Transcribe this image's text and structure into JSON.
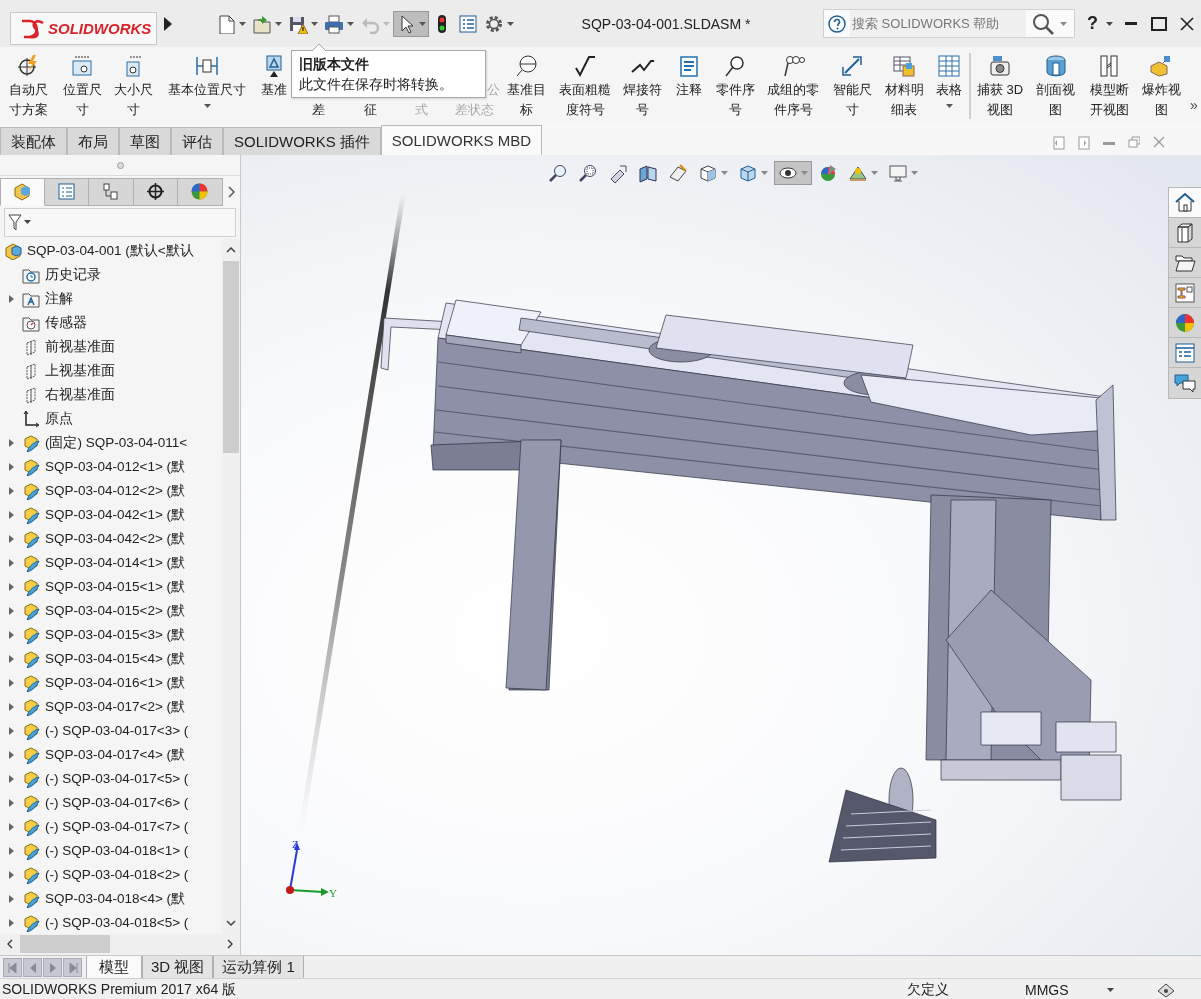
{
  "title_bar": {
    "logo": "SOLIDWORKS",
    "document_title": "SQP-03-04-001.SLDASM *",
    "search": {
      "placeholder": "搜索 SOLIDWORKS 帮助"
    },
    "help": "?"
  },
  "quick_access": [
    {
      "dropdown": true,
      "disabled": false,
      "pressed": false
    },
    {
      "dropdown": true,
      "disabled": false,
      "pressed": false
    },
    {
      "dropdown": true,
      "disabled": false,
      "pressed": false
    },
    {
      "dropdown": true,
      "disabled": false,
      "pressed": false
    },
    {
      "dropdown": true,
      "disabled": true,
      "pressed": false
    },
    {
      "dropdown": true,
      "disabled": false,
      "pressed": true
    },
    {
      "dropdown": false,
      "disabled": false,
      "pressed": false
    },
    {
      "dropdown": false,
      "disabled": false,
      "pressed": false
    },
    {
      "dropdown": true,
      "disabled": false,
      "pressed": false
    }
  ],
  "ribbon": [
    {
      "lines": [
        "自动尺",
        "寸方案"
      ],
      "covered": false,
      "disabled": false,
      "dropdown": false
    },
    {
      "lines": [
        "位置尺",
        "寸"
      ],
      "covered": false,
      "disabled": false,
      "dropdown": false
    },
    {
      "lines": [
        "大小尺",
        "寸"
      ],
      "covered": false,
      "disabled": false,
      "dropdown": false
    },
    {
      "lines": [
        "基本位置尺寸"
      ],
      "covered": false,
      "disabled": false,
      "dropdown": true
    },
    {
      "lines": [
        "基准"
      ],
      "covered": false,
      "disabled": false,
      "dropdown": false
    },
    {
      "lines": [
        "差"
      ],
      "covered": true,
      "disabled": false,
      "dropdown": false
    },
    {
      "lines": [
        "征"
      ],
      "covered": true,
      "disabled": false,
      "dropdown": false
    },
    {
      "lines": [
        "式"
      ],
      "covered": true,
      "disabled": true,
      "dropdown": false
    },
    {
      "lines": [
        "公",
        "差状态"
      ],
      "covered": true,
      "disabled": true,
      "dropdown": false
    },
    {
      "lines": [
        "基准目",
        "标"
      ],
      "covered": false,
      "disabled": false,
      "dropdown": false
    },
    {
      "lines": [
        "表面粗糙",
        "度符号"
      ],
      "covered": false,
      "disabled": false,
      "dropdown": false
    },
    {
      "lines": [
        "焊接符",
        "号"
      ],
      "covered": false,
      "disabled": false,
      "dropdown": false
    },
    {
      "lines": [
        "注释"
      ],
      "covered": false,
      "disabled": false,
      "dropdown": false
    },
    {
      "lines": [
        "零件序",
        "号"
      ],
      "covered": false,
      "disabled": false,
      "dropdown": false
    },
    {
      "lines": [
        "成组的零",
        "件序号"
      ],
      "covered": false,
      "disabled": false,
      "dropdown": false
    },
    {
      "lines": [
        "智能尺",
        "寸"
      ],
      "covered": false,
      "disabled": false,
      "dropdown": false
    },
    {
      "lines": [
        "材料明",
        "细表"
      ],
      "covered": false,
      "disabled": false,
      "dropdown": false
    },
    {
      "lines": [
        "表格"
      ],
      "covered": false,
      "disabled": false,
      "dropdown": true
    },
    {
      "lines": [
        "捕获 3D",
        "视图"
      ],
      "covered": false,
      "disabled": false,
      "dropdown": false
    },
    {
      "lines": [
        "剖面视",
        "图"
      ],
      "covered": false,
      "disabled": false,
      "dropdown": false
    },
    {
      "lines": [
        "模型断",
        "开视图"
      ],
      "covered": false,
      "disabled": false,
      "dropdown": false
    },
    {
      "lines": [
        "爆炸视",
        "图"
      ],
      "covered": false,
      "disabled": false,
      "dropdown": false
    }
  ],
  "ribbon_more": "»",
  "tooltip": {
    "title": "旧版本文件",
    "text": "此文件在保存时将转换。"
  },
  "command_tabs": [
    {
      "label": "装配体",
      "selected": false
    },
    {
      "label": "布局",
      "selected": false
    },
    {
      "label": "草图",
      "selected": false
    },
    {
      "label": "评估",
      "selected": false
    },
    {
      "label": "SOLIDWORKS 插件",
      "selected": false
    },
    {
      "label": "SOLIDWORKS MBD",
      "selected": true
    }
  ],
  "panel_tabs": [
    {
      "selected": true
    },
    {
      "selected": false
    },
    {
      "selected": false
    },
    {
      "selected": false
    },
    {
      "selected": false
    }
  ],
  "tree": [
    {
      "text": "SQP-03-04-001  (默认<默认",
      "kind": "assembly",
      "expander": false
    },
    {
      "text": "历史记录",
      "kind": "history",
      "expander": false
    },
    {
      "text": "注解",
      "kind": "annotations",
      "expander": true
    },
    {
      "text": "传感器",
      "kind": "sensors",
      "expander": false
    },
    {
      "text": "前视基准面",
      "kind": "plane",
      "expander": false
    },
    {
      "text": "上视基准面",
      "kind": "plane",
      "expander": false
    },
    {
      "text": "右视基准面",
      "kind": "plane",
      "expander": false
    },
    {
      "text": "原点",
      "kind": "origin",
      "expander": false
    },
    {
      "text": "(固定) SQP-03-04-011<",
      "kind": "part",
      "expander": true
    },
    {
      "text": "SQP-03-04-012<1> (默",
      "kind": "part",
      "expander": true
    },
    {
      "text": "SQP-03-04-012<2> (默",
      "kind": "part",
      "expander": true
    },
    {
      "text": "SQP-03-04-042<1> (默",
      "kind": "part",
      "expander": true
    },
    {
      "text": "SQP-03-04-042<2> (默",
      "kind": "part",
      "expander": true
    },
    {
      "text": "SQP-03-04-014<1> (默",
      "kind": "part",
      "expander": true
    },
    {
      "text": "SQP-03-04-015<1> (默",
      "kind": "part",
      "expander": true
    },
    {
      "text": "SQP-03-04-015<2> (默",
      "kind": "part",
      "expander": true
    },
    {
      "text": "SQP-03-04-015<3> (默",
      "kind": "part",
      "expander": true
    },
    {
      "text": "SQP-03-04-015<4> (默",
      "kind": "part",
      "expander": true
    },
    {
      "text": "SQP-03-04-016<1> (默",
      "kind": "part",
      "expander": true
    },
    {
      "text": "SQP-03-04-017<2> (默",
      "kind": "part",
      "expander": true
    },
    {
      "text": "(-) SQP-03-04-017<3> (",
      "kind": "part",
      "expander": true
    },
    {
      "text": "SQP-03-04-017<4> (默",
      "kind": "part",
      "expander": true
    },
    {
      "text": "(-) SQP-03-04-017<5> (",
      "kind": "part",
      "expander": true
    },
    {
      "text": "(-) SQP-03-04-017<6> (",
      "kind": "part",
      "expander": true
    },
    {
      "text": "(-) SQP-03-04-017<7> (",
      "kind": "part",
      "expander": true
    },
    {
      "text": "(-) SQP-03-04-018<1> (",
      "kind": "part",
      "expander": true
    },
    {
      "text": "(-) SQP-03-04-018<2> (",
      "kind": "part",
      "expander": true
    },
    {
      "text": "SQP-03-04-018<4> (默",
      "kind": "part",
      "expander": true
    },
    {
      "text": "(-) SQP-03-04-018<5> (",
      "kind": "part",
      "expander": true
    }
  ],
  "view_toolbar": [
    {
      "dropdown": false,
      "pressed": false
    },
    {
      "dropdown": false,
      "pressed": false
    },
    {
      "dropdown": false,
      "pressed": false
    },
    {
      "dropdown": false,
      "pressed": false
    },
    {
      "dropdown": false,
      "pressed": false
    },
    {
      "dropdown": true,
      "pressed": false
    },
    {
      "dropdown": true,
      "pressed": false
    },
    {
      "dropdown": true,
      "pressed": true
    },
    {
      "dropdown": false,
      "pressed": false
    },
    {
      "dropdown": true,
      "pressed": false
    },
    {
      "dropdown": true,
      "pressed": false
    }
  ],
  "task_pane": [
    {
      "selected": true
    },
    {
      "selected": false
    },
    {
      "selected": false
    },
    {
      "selected": false
    },
    {
      "selected": false
    },
    {
      "selected": false
    },
    {
      "selected": false
    }
  ],
  "triad": {
    "z": "Z",
    "y": "Y"
  },
  "model_tabs": [
    {
      "label": "模型",
      "selected": true
    },
    {
      "label": "3D 视图",
      "selected": false
    },
    {
      "label": "运动算例 1",
      "selected": false
    }
  ],
  "status_bar": {
    "product": "SOLIDWORKS Premium 2017 x64 版",
    "state": "欠定义",
    "units": "MMGS"
  }
}
